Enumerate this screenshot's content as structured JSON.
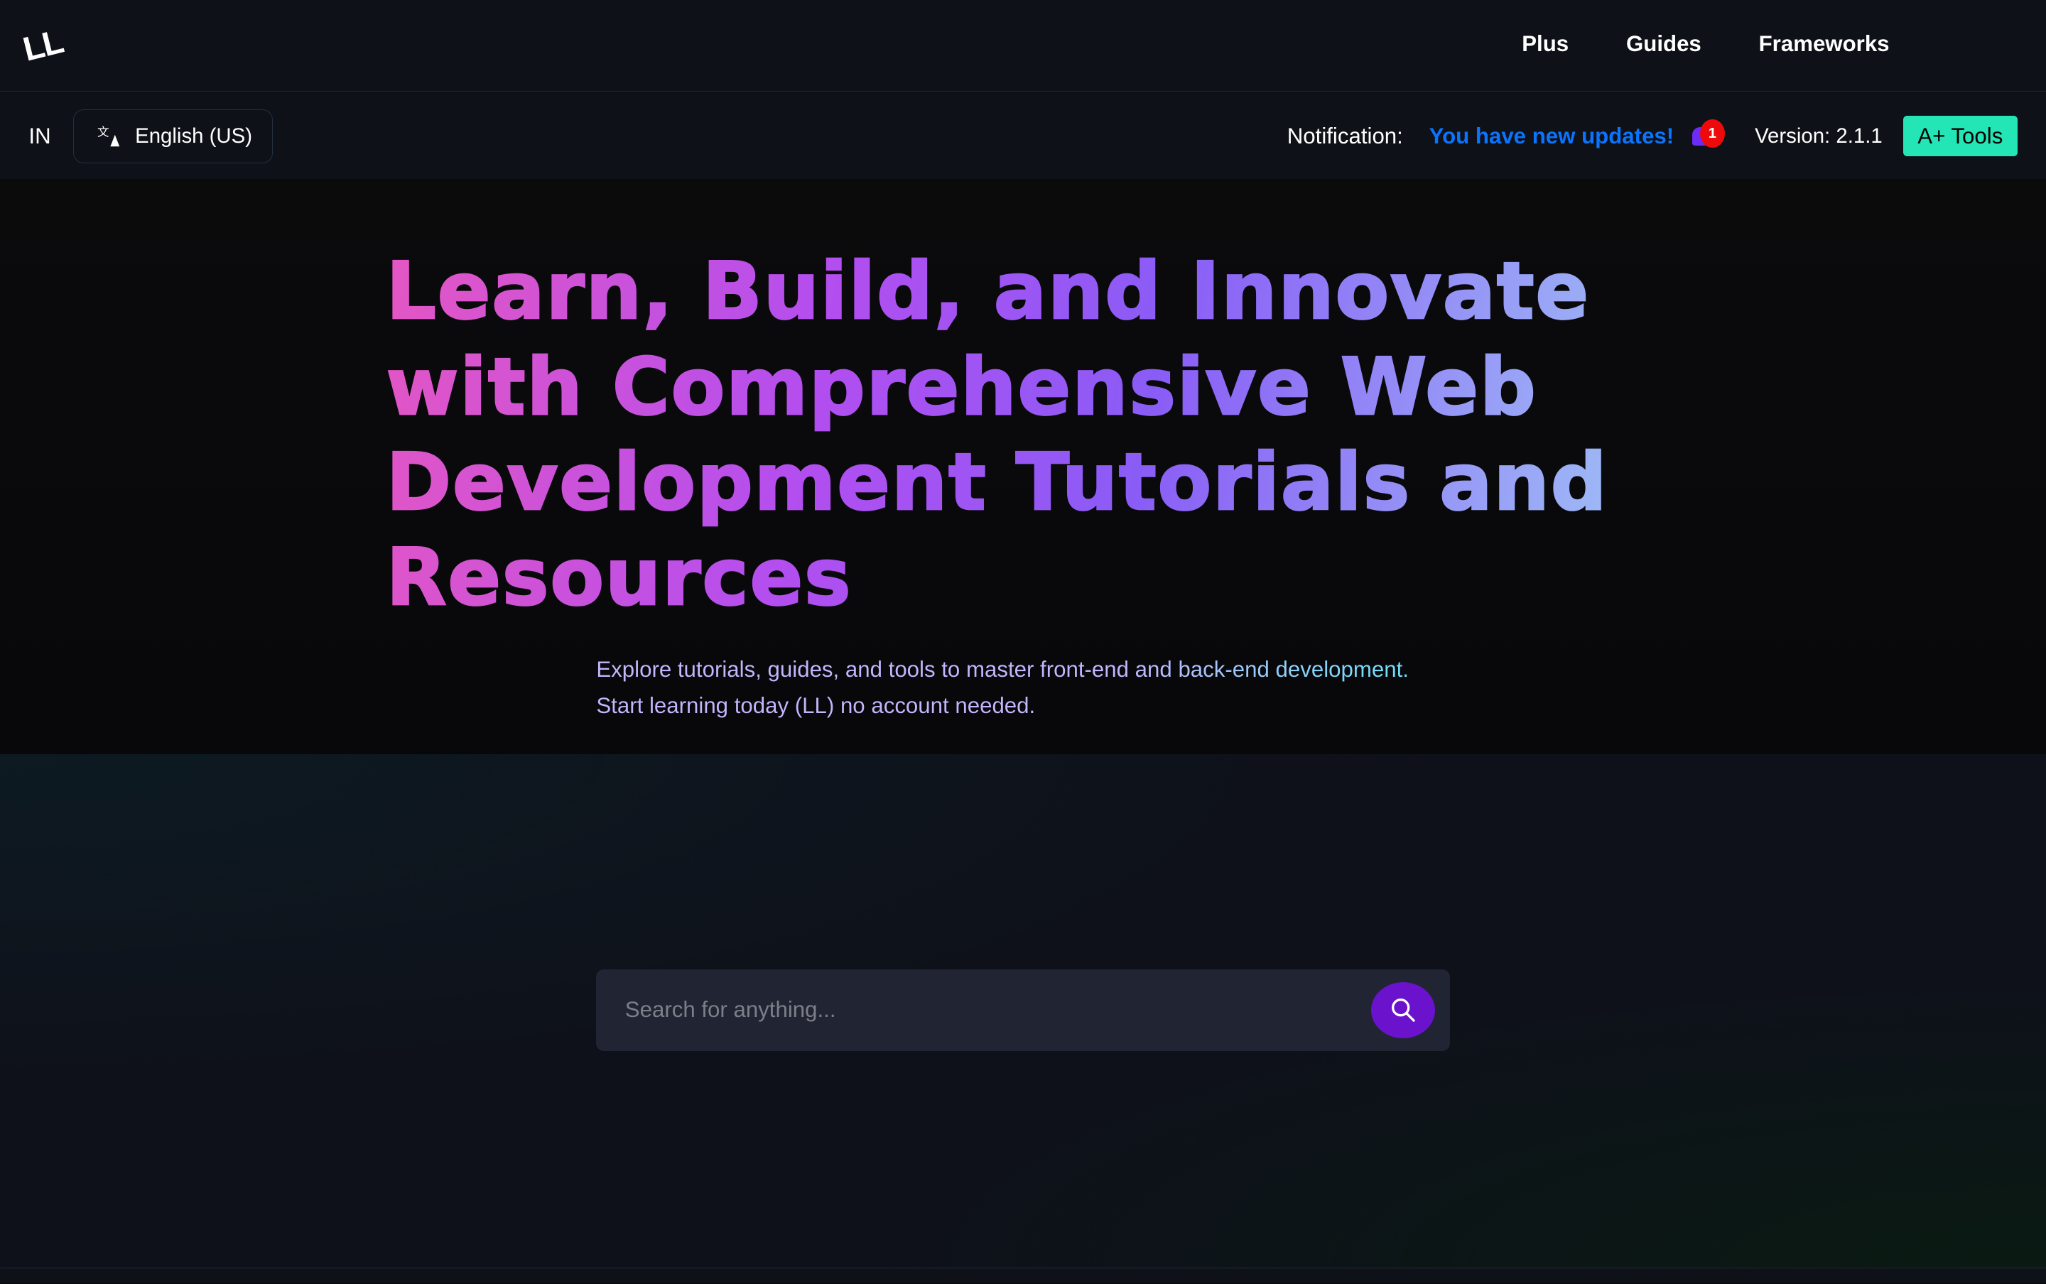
{
  "header": {
    "logo": "LL",
    "nav": [
      {
        "label": "Plus"
      },
      {
        "label": "Guides"
      },
      {
        "label": "Frameworks"
      }
    ]
  },
  "subbar": {
    "region": "IN",
    "language": "English (US)",
    "notification_label": "Notification:",
    "notification_message": "You have new updates!",
    "notification_count": "1",
    "version": "Version: 2.1.1",
    "tools_label": "A+ Tools"
  },
  "hero": {
    "title": "Learn, Build, and Innovate with Comprehensive Web Development Tutorials and Resources",
    "subtitle_line1": "Explore tutorials, guides, and tools to master front-end and back-end development.",
    "subtitle_line2": "Start learning today (LL) no account needed."
  },
  "search": {
    "placeholder": "Search for anything...",
    "value": ""
  },
  "colors": {
    "accent": "#6a12cc",
    "tools_button": "#24e5b5",
    "notification": "#0a74ff",
    "badge": "#ee0a0a"
  }
}
